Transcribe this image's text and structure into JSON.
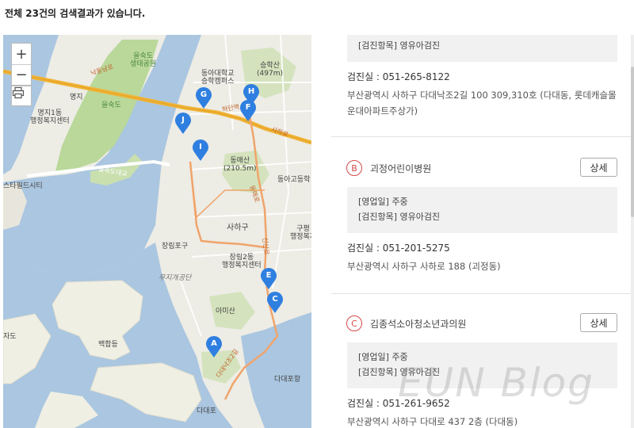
{
  "result_count_text": "전체 23건의 검색결과가 있습니다.",
  "map": {
    "zoom_in": "+",
    "zoom_out": "−",
    "labels": {
      "eulsukdo_park": "을숙도\n생태공원",
      "eulsukdo": "을숙도",
      "myeongji": "명지",
      "myeongji1dong": "명지1동\n행정복지센터",
      "dong_a_univ": "동아대학교\n승학캠퍼스",
      "seunghaksan": "승학산\n(497m)",
      "dongmaesan": "동매산\n(210.5m)",
      "dong_a_high": "동아고등학",
      "saha_gu": "사하구",
      "gupyeong": "구평\n행정복지",
      "jangrim_port": "장림포구",
      "jangrim2dong": "장림2동\n행정복지센터",
      "mujigae": "무지개공단",
      "amisan": "아미산",
      "baekhapdeung": "백합등",
      "jado": "자도",
      "dadaepo": "다대포",
      "dadaeport": "다대포항",
      "field_city": "스타필드시티",
      "road_nakdong": "낙동남로",
      "road_eulsuk": "을숙도대교",
      "road_saha": "사하로",
      "road_dongmae": "동매로",
      "road_sinsan": "신산로",
      "road_dadae": "다대낙조2길",
      "road_hadan": "하단역"
    },
    "pins": [
      "A",
      "C",
      "E",
      "F",
      "G",
      "H",
      "I",
      "J"
    ],
    "colors": {
      "pin": "#2f7fe0",
      "water": "#aac6e0",
      "green": "#b9d89a",
      "highway": "#f1b437"
    }
  },
  "results": [
    {
      "info_lines": [
        "[검진항목] 영유아검진"
      ],
      "phone": "검진실 : 051-265-8122",
      "address": "부산광역시 사하구 다대낙조2길 100 309,310호 (다대동, 롯데캐슬몰운대아파트주상가)"
    },
    {
      "letter": "B",
      "name": "괴정어린이병원",
      "detail_label": "상세",
      "info_lines": [
        "[영업일] 주중",
        "[검진항목] 영유아검진"
      ],
      "phone": "검진실 : 051-201-5275",
      "address": "부산광역시 사하구 사하로 188 (괴정동)"
    },
    {
      "letter": "C",
      "name": "김종석소아청소년과의원",
      "detail_label": "상세",
      "info_lines": [
        "[영업일] 주중",
        "[검진항목] 영유아검진"
      ],
      "phone": "검진실 : 051-261-9652",
      "address": "부산광역시 사하구 다대로 437 2층 (다대동)"
    }
  ],
  "watermark": "EUN Blog"
}
